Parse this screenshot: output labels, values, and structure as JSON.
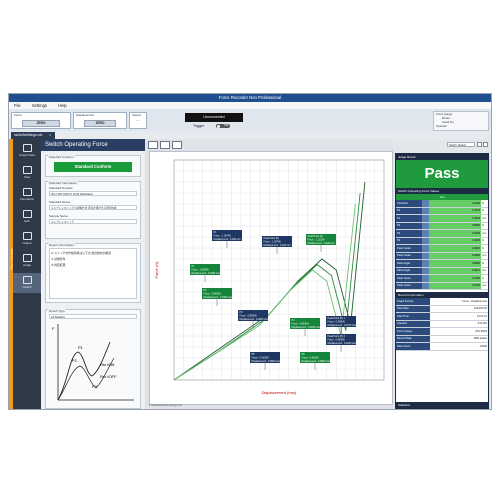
{
  "window": {
    "title": "Force Recorder Neo Professional",
    "menu": [
      "File",
      "Settings",
      "Help"
    ]
  },
  "toolbar": {
    "force": {
      "label": "Force",
      "value": "- - -",
      "button": "ZERO"
    },
    "displacement": {
      "label": "Displacement",
      "value": "- - -",
      "button": "ZERO"
    },
    "speed": {
      "label": "Speed",
      "value": "- -"
    },
    "connection_status": "Unconnected",
    "trigger_label": "Trigger",
    "trigger_state": "OFF",
    "info": [
      "Force Gauge",
      "Model",
      "Serial No.",
      "Operator"
    ]
  },
  "tabs": [
    {
      "label": "studioSmithings.cdx"
    }
  ],
  "sidebar": {
    "strip_label": "Report Settings",
    "items": [
      {
        "label": "Graph Data",
        "icon": "graph-icon"
      },
      {
        "label": "View",
        "icon": "view-icon"
      },
      {
        "label": "Annotation",
        "icon": "annotation-icon"
      },
      {
        "label": "Edit",
        "icon": "edit-icon"
      },
      {
        "label": "Output",
        "icon": "output-icon"
      },
      {
        "label": "Judge",
        "icon": "judge-icon"
      },
      {
        "label": "Switch",
        "icon": "switch-icon"
      }
    ]
  },
  "main": {
    "title": "Switch Operating Force",
    "standard_conform_title": "Standard Conform",
    "standard_conform_button": "Standard Conform",
    "standard_info_title": "Standard Information",
    "standard_number_label": "Standard Number",
    "standard_number_value": "JIS C 6571(JIS-Tf, JIS B Withdrawn)",
    "standard_name_label": "Standard Name",
    "standard_name_value": "メンブレンスイッチの試験方法  近接を測定する測定技術",
    "sample_name_label": "Sample Name",
    "sample_name_value": "メンブレンスイッチ",
    "report_info_title": "Report Information",
    "notes": [
      "① スイッチの作動荷重は以下の 適合値内か確認",
      "② 試験条件",
      "③ 判定結果"
    ],
    "result_type_title": "Result Type",
    "result_type_value": "All Statistics"
  },
  "diagram": {
    "ylabel": "F",
    "p1": "P1",
    "p2": "P2",
    "pw": "P2",
    "ron": "Rsr tON",
    "roff": "Rsr tOFF"
  },
  "chart_tools": [
    "graph-tool-icon",
    "zoom-tool-icon",
    "image-tool-icon"
  ],
  "chart_data": {
    "type": "line",
    "xlabel": "Displacement (mm)",
    "ylabel": "Force (N)",
    "grid": true,
    "series": [
      {
        "x": [
          0.0,
          0.5,
          1.0,
          1.3,
          1.55,
          1.7,
          1.85,
          2.0
        ],
        "y": [
          0.0,
          0.3,
          0.6,
          0.9,
          1.1,
          1.0,
          0.5,
          1.8
        ]
      },
      {
        "x": [
          0.0,
          0.45,
          0.95,
          1.25,
          1.5,
          1.65,
          1.8,
          1.95
        ],
        "y": [
          0.0,
          0.25,
          0.55,
          0.85,
          1.05,
          0.95,
          0.45,
          1.7
        ]
      },
      {
        "x": [
          0.0,
          0.4,
          0.9,
          1.2,
          1.45,
          1.6,
          1.75,
          1.9
        ],
        "y": [
          0.0,
          0.22,
          0.5,
          0.8,
          1.0,
          0.9,
          0.4,
          1.6
        ]
      }
    ],
    "annotations": [
      {
        "title": "P1",
        "force": "Force : 1.1079N",
        "disp": "Displacement : 0.400 mm",
        "color": "#1f3763"
      },
      {
        "title": "Peak Point (P)",
        "force": "Force : 1.1079N",
        "disp": "Displacement : 0.426 mm",
        "color": "#1f3763"
      },
      {
        "title": "Peak Point (A)",
        "force": "Force : 1.1123N",
        "disp": "Displacement : 0.426 mm",
        "color": "#14853a"
      },
      {
        "title": "P1",
        "force": "Force : 1.0000N",
        "disp": "Displacement : 0.3464 mm",
        "color": "#14853a"
      },
      {
        "title": "P2",
        "force": "Force : 0.8450N",
        "disp": "Displacement : 0.4364 mm",
        "color": "#14853a"
      },
      {
        "title": "P3",
        "force": "Force : 0.8300N",
        "disp": "Displacement : 0.2060 mm",
        "color": "#1f3763"
      },
      {
        "title": "P4",
        "force": "Force : 0.8300N",
        "disp": "Displacement : 0.4036 mm",
        "color": "#14853a"
      },
      {
        "title": "Peak Point (P) 1",
        "force": "Force : 0.4200N",
        "disp": "Displacement : 0.4470 mm",
        "color": "#1f3763"
      },
      {
        "title": "Peak Point (P) 2",
        "force": "Force : 0.4200N",
        "disp": "Displacement : 0.4240 mm",
        "color": "#1f3763"
      },
      {
        "title": "P5",
        "force": "Force : 0.4100N",
        "disp": "Displacement : 0.3660 mm",
        "color": "#1f3763"
      },
      {
        "title": "P6",
        "force": "Force : 0.4300N",
        "disp": "Displacement : 0.3960 mm",
        "color": "#14853a"
      }
    ]
  },
  "file_path": "C:\\Data\\StudioSmithings.cdx",
  "right_panel": {
    "select_value": "Switch 1Select",
    "judge_title": "Judge Result",
    "pass_text": "Pass",
    "values_title": "Switch Operating Force Values",
    "yes_text": "Yes",
    "rows": [
      {
        "name": "Ccriterion",
        "value": "0.1000",
        "unit": "N"
      },
      {
        "name": "P1",
        "value": "1.1079",
        "unit": "N"
      },
      {
        "name": "P1",
        "value": "0.4364",
        "unit": "mm"
      },
      {
        "name": "P2",
        "value": "0.8450",
        "unit": "N"
      },
      {
        "name": "P2",
        "value": "0.4030",
        "unit": "mm"
      },
      {
        "name": "P3",
        "value": "0.4200",
        "unit": "N"
      },
      {
        "name": "Peak Cadar",
        "value": "1.0000",
        "unit": "N"
      },
      {
        "name": "Peak Cadar",
        "value": "0.4060",
        "unit": "mm"
      },
      {
        "name": "Peak Angle",
        "value": "0.9880",
        "unit": "N"
      },
      {
        "name": "Pack Angle",
        "value": "0.4010",
        "unit": "mm"
      },
      {
        "name": "Peak Vower",
        "value": "0.4100",
        "unit": "N"
      },
      {
        "name": "Peak Vower",
        "value": "0.3700",
        "unit": "mm"
      }
    ],
    "record_title": "Record Information",
    "record_rows": [
      {
        "name": "Graph Format",
        "value": "Force - Displacement"
      },
      {
        "name": "Start Date",
        "value": "2024/07/22"
      },
      {
        "name": "Start Time",
        "value": "13:27:12"
      },
      {
        "name": "Operator",
        "value": "ZTA-DN"
      },
      {
        "name": "Force Gauge",
        "value": "ZTA-500N"
      },
      {
        "name": "Record Rate",
        "value": "1000 data/s"
      },
      {
        "name": "Data Count",
        "value": "10000"
      }
    ],
    "footer": "Statistics"
  }
}
